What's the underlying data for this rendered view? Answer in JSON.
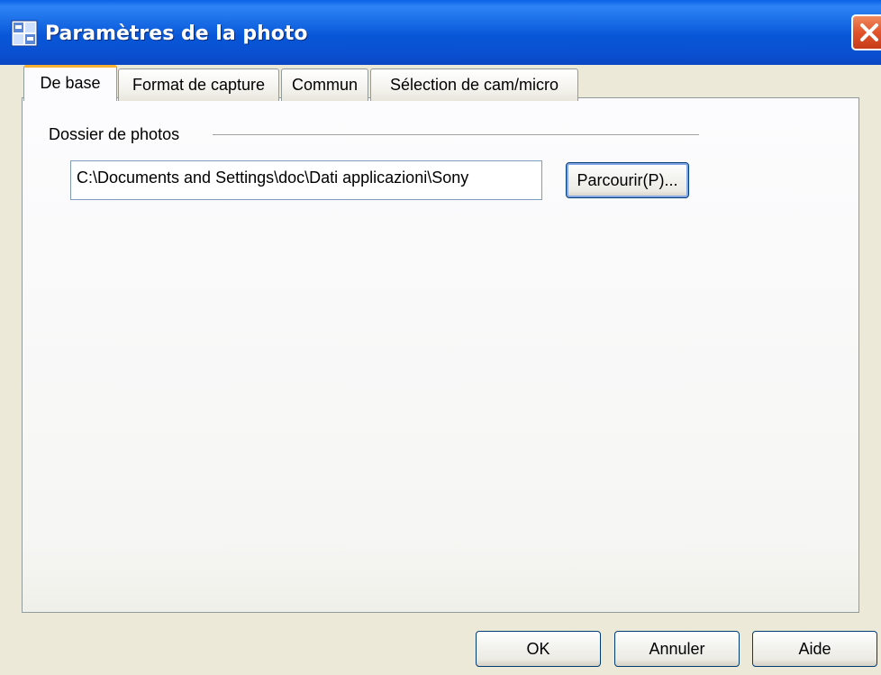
{
  "window": {
    "title": "Paramètres de la photo",
    "accent_color": "#0a4fd0"
  },
  "tabs": [
    {
      "label": "De base",
      "active": true
    },
    {
      "label": "Format de capture",
      "active": false
    },
    {
      "label": "Commun",
      "active": false
    },
    {
      "label": "Sélection de cam/micro",
      "active": false
    }
  ],
  "photo_folder": {
    "group_label": "Dossier de photos",
    "path_value": "C:\\Documents and Settings\\doc\\Dati applicazioni\\Sony",
    "browse_label": "Parcourir(P)..."
  },
  "footer": {
    "ok_label": "OK",
    "cancel_label": "Annuler",
    "help_label": "Aide"
  },
  "icons": {
    "app": "photo-settings-icon",
    "close": "close-icon"
  }
}
